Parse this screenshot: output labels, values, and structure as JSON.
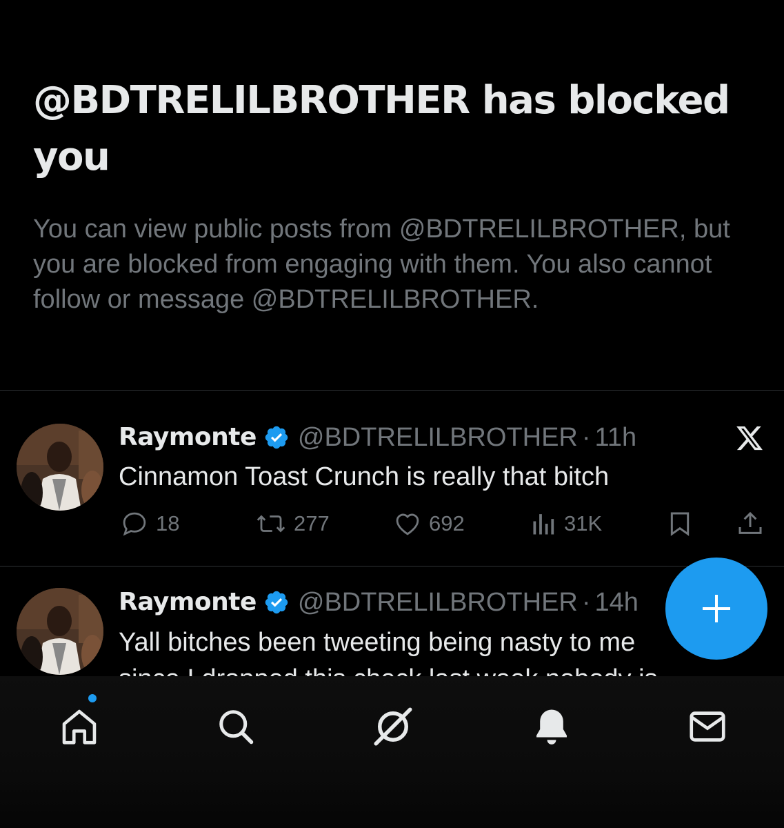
{
  "blocked": {
    "title": "@BDTRELILBROTHER has blocked you",
    "description": "You can view public posts from @BDTRELILBROTHER, but you are blocked from engaging with them. You also cannot follow or message @BDTRELILBROTHER."
  },
  "posts": [
    {
      "author": "Raymonte",
      "handle": "@BDTRELILBROTHER",
      "separator": "·",
      "time": "11h",
      "text": "Cinnamon Toast Crunch is really that bitch",
      "replies": "18",
      "reposts": "277",
      "likes": "692",
      "views": "31K"
    },
    {
      "author": "Raymonte",
      "handle": "@BDTRELILBROTHER",
      "separator": "·",
      "time": "14h",
      "text": "Yall bitches been tweeting being nasty to me",
      "text_line2": "since I dropped this check last week nobody is"
    }
  ],
  "colors": {
    "background": "#000000",
    "primary_text": "#e7e9ea",
    "secondary_text": "#71767b",
    "accent": "#1d9bf0",
    "divider": "#2f3336"
  },
  "icons": {
    "verified": "verified-badge-icon",
    "brand": "x-logo-icon",
    "fab": "plus-icon",
    "nav": [
      "home-icon",
      "search-icon",
      "grok-icon",
      "bell-icon",
      "mail-icon"
    ]
  }
}
